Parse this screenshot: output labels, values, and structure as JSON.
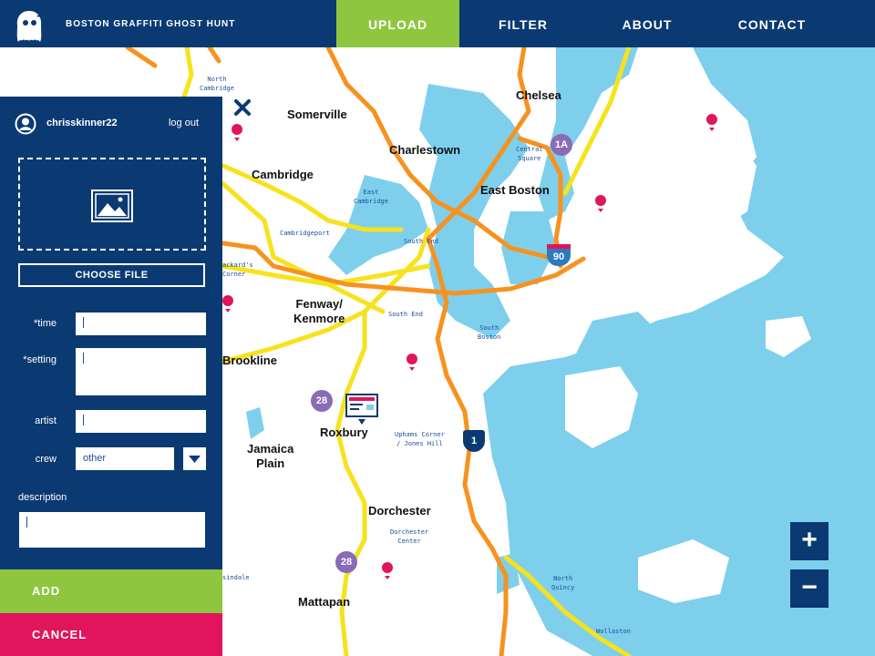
{
  "header": {
    "brand": "BOSTON GRAFFITI GHOST HUNT",
    "nav": [
      {
        "label": "UPLOAD",
        "active": true
      },
      {
        "label": "FILTER",
        "active": false
      },
      {
        "label": "ABOUT",
        "active": false
      },
      {
        "label": "CONTACT",
        "active": false
      }
    ]
  },
  "panel": {
    "username": "chrisskinner22",
    "logout": "log out",
    "choose_file": "CHOOSE FILE",
    "fields": {
      "time_label": "*time",
      "setting_label": "*setting",
      "artist_label": "artist",
      "crew_label": "crew",
      "crew_value": "other",
      "description_label": "description"
    },
    "add": "ADD",
    "cancel": "CANCEL"
  },
  "map": {
    "neighborhoods": [
      "Somerville",
      "Charlestown",
      "Chelsea",
      "Cambridge",
      "East Boston",
      "Fenway/\nKenmore",
      "Brookline",
      "Roxbury",
      "Jamaica\nPlain",
      "Dorchester",
      "Mattapan"
    ],
    "small_labels": [
      "North\nCambridge",
      "Central\nSquare",
      "East\nCambridge",
      "Cambridgeport",
      "South End",
      "ackard's\nCorner",
      "South End",
      "South\nBoston",
      "Uphams Corner\n/ Jones Hill",
      "Dorchester\nCenter",
      "North\nQuincy",
      "sindale",
      "Wollaston"
    ],
    "route_shields": [
      "1A",
      "90",
      "28",
      "1",
      "28"
    ],
    "zoom_in": "+",
    "zoom_out": "−"
  },
  "colors": {
    "navy": "#0b3a72",
    "green": "#8ec640",
    "pink": "#e0155b",
    "water": "#7ecfec",
    "highway_orange": "#f7921e",
    "road_yellow": "#f7e21e",
    "route_purple": "#8a6bb5"
  }
}
